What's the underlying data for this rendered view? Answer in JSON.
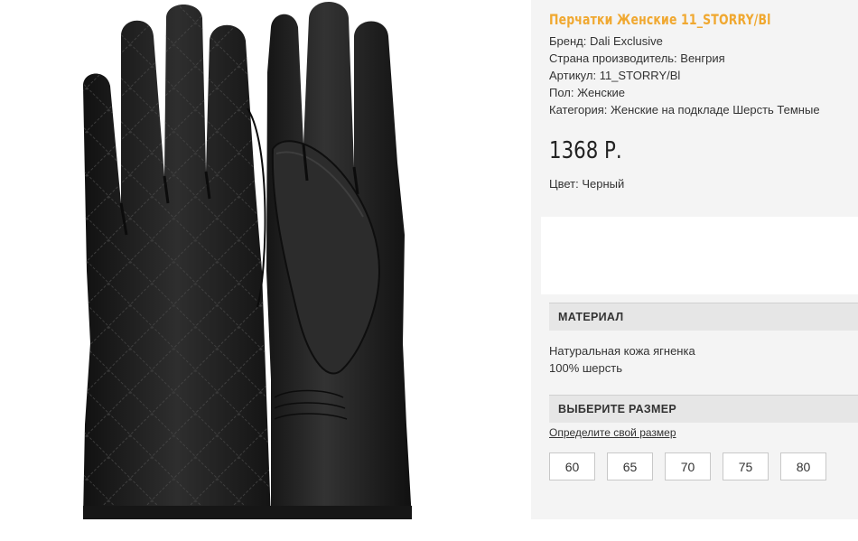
{
  "product": {
    "title": "Перчатки Женские 11_STORRY/Bl",
    "specs": [
      "Бренд: Dali Exclusive",
      "Страна производитель: Венгрия",
      "Артикул: 11_STORRY/Bl",
      "Пол: Женские",
      "Категория: Женские на подкладе Шерсть Темные"
    ],
    "price": "1368 Р.",
    "color": "Цвет: Черный",
    "image": "black-leather-quilted-gloves"
  },
  "material": {
    "heading": "МАТЕРИАЛ",
    "lines": [
      "Натуральная кожа ягненка",
      "100% шерсть"
    ]
  },
  "size_section": {
    "heading": "ВЫБЕРИТЕ РАЗМЕР",
    "link": "Определите свой размер",
    "sizes": [
      "60",
      "65",
      "70",
      "75",
      "80"
    ]
  },
  "colors": {
    "title": "#f0a830",
    "panel": "#f4f4f4",
    "section_header": "#e6e6e6",
    "glove": "#1c1c1c"
  }
}
